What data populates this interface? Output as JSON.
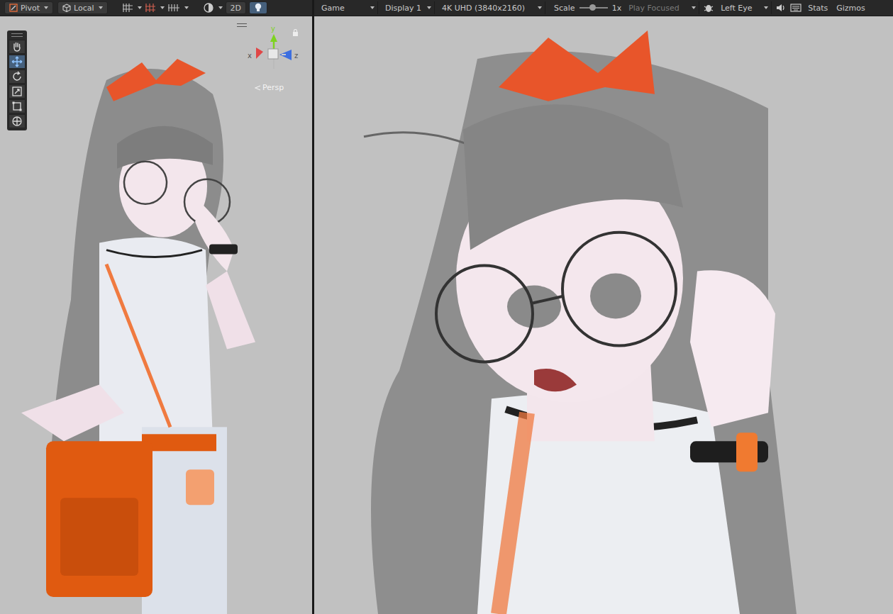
{
  "scene_toolbar": {
    "pivot": "Pivot",
    "space": "Local",
    "mode_2d": {
      "label": "2D",
      "selected": false
    },
    "lighting": {
      "selected": true
    }
  },
  "tools": [
    {
      "kind": "hand",
      "selected": false
    },
    {
      "kind": "move",
      "selected": true
    },
    {
      "kind": "rotate",
      "selected": false
    },
    {
      "kind": "scale",
      "selected": false
    },
    {
      "kind": "rect",
      "selected": false
    },
    {
      "kind": "transform",
      "selected": false
    }
  ],
  "orientation_gizmo": {
    "axes": [
      {
        "label": "y",
        "color": "#7ed321"
      },
      {
        "label": "x",
        "color": "#e04646"
      },
      {
        "label": "z",
        "color": "#3c6ee0"
      }
    ],
    "projection": "Persp"
  },
  "game_toolbar": {
    "view": "Game",
    "display": "Display 1",
    "resolution": "4K UHD (3840x2160)",
    "scale": {
      "label": "Scale",
      "level": 0.45,
      "reading": "1x"
    },
    "play_mode": {
      "label": "Play Focused",
      "disabled": true
    },
    "eye": "Left Eye",
    "stats": "Stats",
    "gizmos": "Gizmos"
  }
}
